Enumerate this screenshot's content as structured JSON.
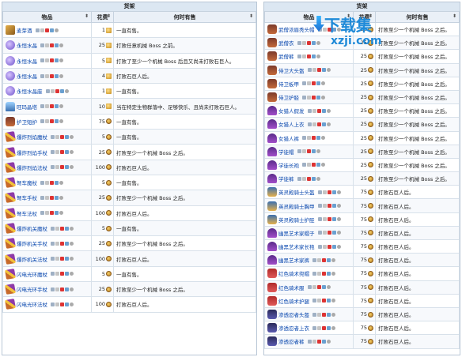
{
  "left": {
    "caption": "货架",
    "headers": {
      "item": "物品",
      "cost": "花费",
      "when": "何时有售"
    },
    "rows": [
      {
        "name": "麦芽酒",
        "icon": "ale-icon",
        "cls": "ammo",
        "cost": "1",
        "coin": "gold",
        "cond": "一直有售。"
      },
      {
        "name": "永恒水晶",
        "icon": "crystal-icon",
        "cls": "crystal",
        "cost": "25",
        "coin": "gold",
        "cond": "打败任意机械 Boss 之前。"
      },
      {
        "name": "永恒水晶",
        "icon": "crystal-icon",
        "cls": "crystal",
        "cost": "5",
        "coin": "gold",
        "cond": "打败了至少一个机械 Boss 后且又尚未打败石巨人。"
      },
      {
        "name": "永恒水晶",
        "icon": "crystal-icon",
        "cls": "crystal",
        "cost": "4",
        "coin": "gold",
        "cond": "打败石巨人后。"
      },
      {
        "name": "永恒水晶座",
        "icon": "crystal-stand-icon",
        "cls": "crystal",
        "cost": "1",
        "coin": "gold",
        "cond": "一直有售。"
      },
      {
        "name": "旺玛晶塔",
        "icon": "pylon-icon",
        "cls": "tower",
        "cost": "10",
        "coin": "gold",
        "cond": "当在特定生物群落中、足够快乐、且尚未打败石巨人。"
      },
      {
        "name": "护卫短护",
        "icon": "defender-icon",
        "cls": "armor",
        "cost": "75",
        "coin": "medal",
        "cond": "一直有售。"
      },
      {
        "name": "爆炸烈焰魔杖",
        "icon": "staff-icon",
        "cls": "staff",
        "cost": "5",
        "coin": "medal",
        "cond": "一直有售。"
      },
      {
        "name": "爆炸烈焰手杖",
        "icon": "staff-icon",
        "cls": "staff",
        "cost": "25",
        "coin": "medal",
        "cond": "打败至少一个机械 Boss 之后。"
      },
      {
        "name": "爆炸烈焰法杖",
        "icon": "staff-icon",
        "cls": "staff",
        "cost": "100",
        "coin": "medal",
        "cond": "打败石巨人后。"
      },
      {
        "name": "弩车魔杖",
        "icon": "ballista-icon",
        "cls": "staff",
        "cost": "5",
        "coin": "medal",
        "cond": "一直有售。"
      },
      {
        "name": "弩车手杖",
        "icon": "ballista-icon",
        "cls": "staff",
        "cost": "25",
        "coin": "medal",
        "cond": "打败至少一个机械 Boss 之后。"
      },
      {
        "name": "弩车法杖",
        "icon": "ballista-icon",
        "cls": "staff",
        "cost": "100",
        "coin": "medal",
        "cond": "打败石巨人后。"
      },
      {
        "name": "爆炸机关魔杖",
        "icon": "trap-icon",
        "cls": "staff",
        "cost": "5",
        "coin": "medal",
        "cond": "一直有售。"
      },
      {
        "name": "爆炸机关手杖",
        "icon": "trap-icon",
        "cls": "staff",
        "cost": "25",
        "coin": "medal",
        "cond": "打败至少一个机械 Boss 之后。"
      },
      {
        "name": "爆炸机关法杖",
        "icon": "trap-icon",
        "cls": "staff",
        "cost": "100",
        "coin": "medal",
        "cond": "打败石巨人后。"
      },
      {
        "name": "闪电光环魔杖",
        "icon": "lightning-icon",
        "cls": "staff",
        "cost": "5",
        "coin": "medal",
        "cond": "一直有售。"
      },
      {
        "name": "闪电光环手杖",
        "icon": "lightning-icon",
        "cls": "staff",
        "cost": "25",
        "coin": "medal",
        "cond": "打败至少一个机械 Boss 之后。"
      },
      {
        "name": "闪电光环法杖",
        "icon": "lightning-icon",
        "cls": "staff",
        "cost": "100",
        "coin": "medal",
        "cond": "打败石巨人后。"
      }
    ]
  },
  "right": {
    "caption": "货架",
    "headers": {
      "item": "物品",
      "cost": "花费",
      "when": "何时有售"
    },
    "rows": [
      {
        "name": "武僧浓眉秃头帽",
        "icon": "monk-hat-icon",
        "cls": "armor",
        "cost": "25",
        "coin": "medal",
        "cond": "打败至少一个机械 Boss 之后。"
      },
      {
        "name": "武僧衣",
        "icon": "monk-shirt-icon",
        "cls": "armor",
        "cost": "25",
        "coin": "medal",
        "cond": "打败至少一个机械 Boss 之后。"
      },
      {
        "name": "武僧裤",
        "icon": "monk-pants-icon",
        "cls": "armor",
        "cost": "25",
        "coin": "medal",
        "cond": "打败至少一个机械 Boss 之后。"
      },
      {
        "name": "侍卫大头盔",
        "icon": "squire-helmet-icon",
        "cls": "armor",
        "cost": "25",
        "coin": "medal",
        "cond": "打败至少一个机械 Boss 之后。"
      },
      {
        "name": "侍卫板甲",
        "icon": "squire-plate-icon",
        "cls": "armor",
        "cost": "25",
        "coin": "medal",
        "cond": "打败至少一个机械 Boss 之后。"
      },
      {
        "name": "侍卫护胫",
        "icon": "squire-greaves-icon",
        "cls": "armor",
        "cost": "25",
        "coin": "medal",
        "cond": "打败至少一个机械 Boss 之后。"
      },
      {
        "name": "女猎人假发",
        "icon": "huntress-wig-icon",
        "cls": "hat",
        "cost": "25",
        "coin": "medal",
        "cond": "打败至少一个机械 Boss 之后。"
      },
      {
        "name": "女猎人上衣",
        "icon": "huntress-top-icon",
        "cls": "hat",
        "cost": "25",
        "coin": "medal",
        "cond": "打败至少一个机械 Boss 之后。"
      },
      {
        "name": "女猎人裤",
        "icon": "huntress-pants-icon",
        "cls": "hat",
        "cost": "25",
        "coin": "medal",
        "cond": "打败至少一个机械 Boss 之后。"
      },
      {
        "name": "学徒帽",
        "icon": "apprentice-hat-icon",
        "cls": "hat",
        "cost": "25",
        "coin": "medal",
        "cond": "打败至少一个机械 Boss 之后。"
      },
      {
        "name": "学徒长袍",
        "icon": "apprentice-robe-icon",
        "cls": "hat",
        "cost": "25",
        "coin": "medal",
        "cond": "打败至少一个机械 Boss 之后。"
      },
      {
        "name": "学徒裤",
        "icon": "apprentice-pants-icon",
        "cls": "hat",
        "cost": "25",
        "coin": "medal",
        "cond": "打败至少一个机械 Boss 之后。"
      },
      {
        "name": "英灵殿骑士头盔",
        "icon": "valhalla-helm-icon",
        "cls": "pal",
        "cost": "75",
        "coin": "medal",
        "cond": "打败石巨人后。"
      },
      {
        "name": "英灵殿骑士胸甲",
        "icon": "valhalla-plate-icon",
        "cls": "pal",
        "cost": "75",
        "coin": "medal",
        "cond": "打败石巨人后。"
      },
      {
        "name": "英灵殿骑士护胫",
        "icon": "valhalla-greaves-icon",
        "cls": "pal",
        "cost": "75",
        "coin": "medal",
        "cond": "打败石巨人后。"
      },
      {
        "name": "幽黑艺术家帽子",
        "icon": "dark-artist-hat-icon",
        "cls": "hat",
        "cost": "75",
        "coin": "medal",
        "cond": "打败石巨人后。"
      },
      {
        "name": "幽黑艺术家长袍",
        "icon": "dark-artist-robe-icon",
        "cls": "hat",
        "cost": "75",
        "coin": "medal",
        "cond": "打败石巨人后。"
      },
      {
        "name": "幽黑艺术家裤",
        "icon": "dark-artist-pants-icon",
        "cls": "hat",
        "cost": "75",
        "coin": "medal",
        "cond": "打败石巨人后。"
      },
      {
        "name": "红色骑术兜帽",
        "icon": "red-hood-icon",
        "cls": "red",
        "cost": "75",
        "coin": "medal",
        "cond": "打败石巨人后。"
      },
      {
        "name": "红色骑术服",
        "icon": "red-dress-icon",
        "cls": "red",
        "cost": "75",
        "coin": "medal",
        "cond": "打败石巨人后。"
      },
      {
        "name": "红色骑术护腿",
        "icon": "red-leggings-icon",
        "cls": "red",
        "cost": "75",
        "coin": "medal",
        "cond": "打败石巨人后。"
      },
      {
        "name": "渗透忍者头盔",
        "icon": "ninja-helmet-icon",
        "cls": "ninja",
        "cost": "75",
        "coin": "medal",
        "cond": "打败石巨人后。"
      },
      {
        "name": "渗透忍者上衣",
        "icon": "ninja-top-icon",
        "cls": "ninja",
        "cost": "75",
        "coin": "medal",
        "cond": "打败石巨人后。"
      },
      {
        "name": "渗透忍者裤",
        "icon": "ninja-pants-icon",
        "cls": "ninja",
        "cost": "75",
        "coin": "medal",
        "cond": "打败石巨人后。"
      }
    ]
  },
  "watermark": {
    "line1": "下载集",
    "line2": "xzji.com"
  }
}
